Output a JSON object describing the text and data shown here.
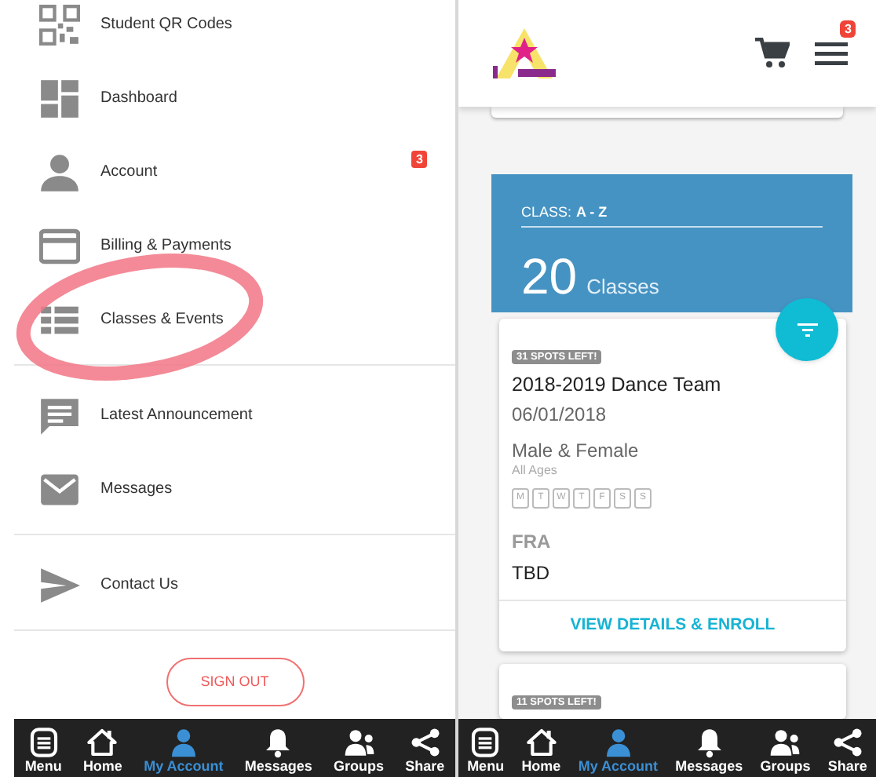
{
  "left_panel": {
    "menu_groups": [
      [
        {
          "label": "Student QR Codes"
        },
        {
          "label": "Dashboard"
        },
        {
          "label": "Account",
          "badge": "3"
        },
        {
          "label": "Billing & Payments"
        },
        {
          "label": "Classes & Events"
        }
      ],
      [
        {
          "label": "Latest Announcement"
        },
        {
          "label": "Messages"
        }
      ],
      [
        {
          "label": "Contact Us"
        }
      ]
    ],
    "sign_out": "SIGN OUT",
    "nav": [
      {
        "label": "Menu",
        "selected": false
      },
      {
        "label": "Home",
        "selected": false
      },
      {
        "label": "My Account",
        "selected": true
      },
      {
        "label": "Messages",
        "selected": false
      },
      {
        "label": "Groups",
        "selected": false
      },
      {
        "label": "Share",
        "selected": false
      }
    ]
  },
  "right_panel": {
    "header": {
      "menu_badge": "3"
    },
    "summary": {
      "filter_label": "CLASS:",
      "filter_value": "A - Z",
      "count": "20",
      "count_label": "Classes"
    },
    "cards": [
      {
        "spots": "31 SPOTS LEFT!",
        "title": "2018-2019 Dance Team",
        "date": "06/01/2018",
        "gender": "Male & Female",
        "ages": "All Ages",
        "days": [
          "M",
          "T",
          "W",
          "T",
          "F",
          "S",
          "S"
        ],
        "location": "FRA",
        "time": "TBD",
        "action": "VIEW DETAILS & ENROLL"
      },
      {
        "spots": "11 SPOTS LEFT!"
      }
    ],
    "nav": [
      {
        "label": "Menu",
        "selected": false
      },
      {
        "label": "Home",
        "selected": false
      },
      {
        "label": "My Account",
        "selected": true
      },
      {
        "label": "Messages",
        "selected": false
      },
      {
        "label": "Groups",
        "selected": false
      },
      {
        "label": "Share",
        "selected": false
      }
    ]
  }
}
